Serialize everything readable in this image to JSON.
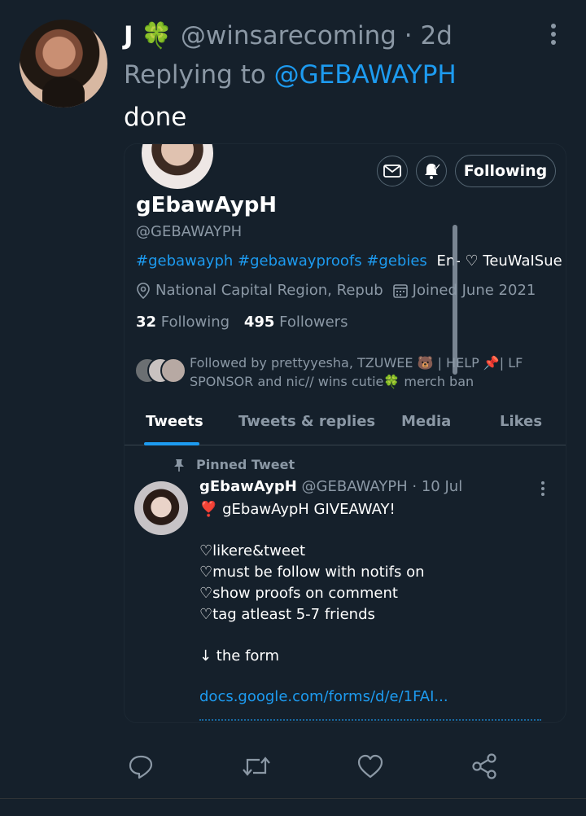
{
  "tweet": {
    "display_name": "J",
    "name_emoji": "🍀",
    "handle": "@winsarecoming",
    "time": "· 2d",
    "replying_prefix": "Replying to",
    "replying_handle": "@GEBAWAYPH",
    "text": "done"
  },
  "profile_card": {
    "following_label": "Following",
    "name": "gEbawAypH",
    "handle": "@GEBAWAYPH",
    "bio_tags": "#gebawayph #gebawayproofs #gebies",
    "bio_rest": "En- ♡ TeuWaISue",
    "location": "National Capital Region, Repub",
    "joined": "Joined June 2021",
    "following_count": "32",
    "following_label_stat": "Following",
    "followers_count": "495",
    "followers_label": "Followers",
    "followed_by_line1": "Followed by prettyyesha, TZUWEE 🐻 | HELP 📌| LF",
    "followed_by_line2": "SPONSOR and nic// wins cutie🍀 merch ban",
    "tabs": [
      "Tweets",
      "Tweets & replies",
      "Media",
      "Likes"
    ],
    "pinned_label": "Pinned Tweet",
    "pinned_tweet": {
      "name": "gEbawAypH",
      "handle": "@GEBAWAYPH",
      "time": "· 10 Jul",
      "body": "❣️ gEbawAypH GIVEAWAY!\n\n♡likere&tweet\n♡must be follow with notifs on\n♡show proofs on comment\n♡tag atleast 5-7 friends\n\n↓ the form",
      "link": "docs.google.com/forms/d/e/1FAI..."
    }
  },
  "icons": {
    "outer_more": "more-vertical-icon",
    "mail": "mail-icon",
    "bell": "bell-notify-icon",
    "location": "location-pin-icon",
    "calendar": "calendar-icon",
    "pin": "pin-icon",
    "reply": "reply-icon",
    "retweet": "retweet-icon",
    "like": "heart-icon",
    "share": "share-icon"
  },
  "colors": {
    "background": "#15202b",
    "accent": "#1d9bf0",
    "secondary_text": "#8b98a5"
  }
}
